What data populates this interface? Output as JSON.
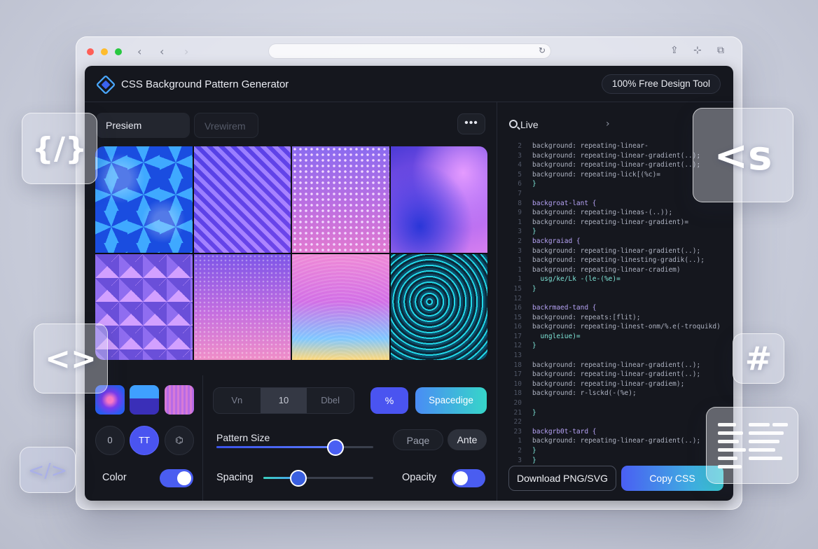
{
  "app": {
    "title": "CSS Background Pattern Generator",
    "badge": "100% Free Design Tool"
  },
  "tabs": [
    {
      "label": "Presiem",
      "active": true
    },
    {
      "label": "Vrewirem",
      "active": false
    }
  ],
  "more_label": "•••",
  "swatches": [
    "radial-pink-blue",
    "split-blue",
    "stripe-violet"
  ],
  "shape_buttons": [
    {
      "label": "0"
    },
    {
      "label": "TT",
      "active": true
    },
    {
      "label": "⌬"
    }
  ],
  "color_toggle": {
    "label": "Color",
    "on": true
  },
  "segmented": [
    {
      "label": "Vn"
    },
    {
      "label": "10",
      "active": true
    },
    {
      "label": "Dbel"
    }
  ],
  "buttons": {
    "x_label": "%",
    "spacing_label": "Spacedige",
    "page_label": "Paqe",
    "ante_label": "Ante"
  },
  "sliders": {
    "pattern_size": {
      "label": "Pattern Size",
      "value": 0.76
    },
    "spacing": {
      "label": "Spacing",
      "value": 0.32
    }
  },
  "opacity_toggle": {
    "label": "Opacity",
    "on": true
  },
  "code_panel": {
    "title": "Live",
    "lines": [
      {
        "n": "2",
        "t": "background: repeating-linear-"
      },
      {
        "n": "3",
        "t": "background: repeating-linear-gradient(..);"
      },
      {
        "n": "4",
        "t": "background: repeating-linear-gradient(..);"
      },
      {
        "n": "5",
        "t": "background: repeating-lick[(%c)="
      },
      {
        "n": "6",
        "t": "}"
      },
      {
        "n": "7",
        "t": ""
      },
      {
        "n": "8",
        "t": "backgroat-lant {"
      },
      {
        "n": "9",
        "t": "background: repeating-lineas-(..));"
      },
      {
        "n": "1",
        "t": "background: repeating-linear-gradient)="
      },
      {
        "n": "3",
        "t": "}"
      },
      {
        "n": "2",
        "t": "backgraiad {"
      },
      {
        "n": "3",
        "t": "background: repeating-linear-gradient(..);"
      },
      {
        "n": "1",
        "t": "background: repeating-linesting-gradik(..);"
      },
      {
        "n": "1",
        "t": "background: repeating-linear-cradiem)"
      },
      {
        "n": "1",
        "t": "  usg/ke/Lk -(le-(%e)="
      },
      {
        "n": "15",
        "t": "}"
      },
      {
        "n": "12",
        "t": ""
      },
      {
        "n": "16",
        "t": "backrmaed-tand {"
      },
      {
        "n": "15",
        "t": "background: repeats:[flit);"
      },
      {
        "n": "16",
        "t": "background: repeating-linest-onm/%.e(-troquikd)"
      },
      {
        "n": "17",
        "t": "  ungleiue)="
      },
      {
        "n": "12",
        "t": "}"
      },
      {
        "n": "13",
        "t": ""
      },
      {
        "n": "18",
        "t": "background: repeating-linear-gradient(..);"
      },
      {
        "n": "17",
        "t": "background: repeating-linear-gradient(..);"
      },
      {
        "n": "10",
        "t": "background: repeating-linear-gradiem);"
      },
      {
        "n": "18",
        "t": "background: r-lsckd(-(%e);"
      },
      {
        "n": "20",
        "t": ""
      },
      {
        "n": "21",
        "t": "}"
      },
      {
        "n": "22",
        "t": ""
      },
      {
        "n": "23",
        "t": "backgrb0t-tard {"
      },
      {
        "n": "1",
        "t": "background: repeating-linear-gradient(..);"
      },
      {
        "n": "2",
        "t": "}"
      },
      {
        "n": "3",
        "t": "}"
      }
    ]
  },
  "actions": {
    "download_label": "Download PNG/SVG",
    "copy_label": "Copy CSS"
  },
  "decor": {
    "code_slash": "{/}",
    "angle": "<>",
    "angle_s": "<s",
    "hash": "#",
    "small_slash": "</>"
  }
}
